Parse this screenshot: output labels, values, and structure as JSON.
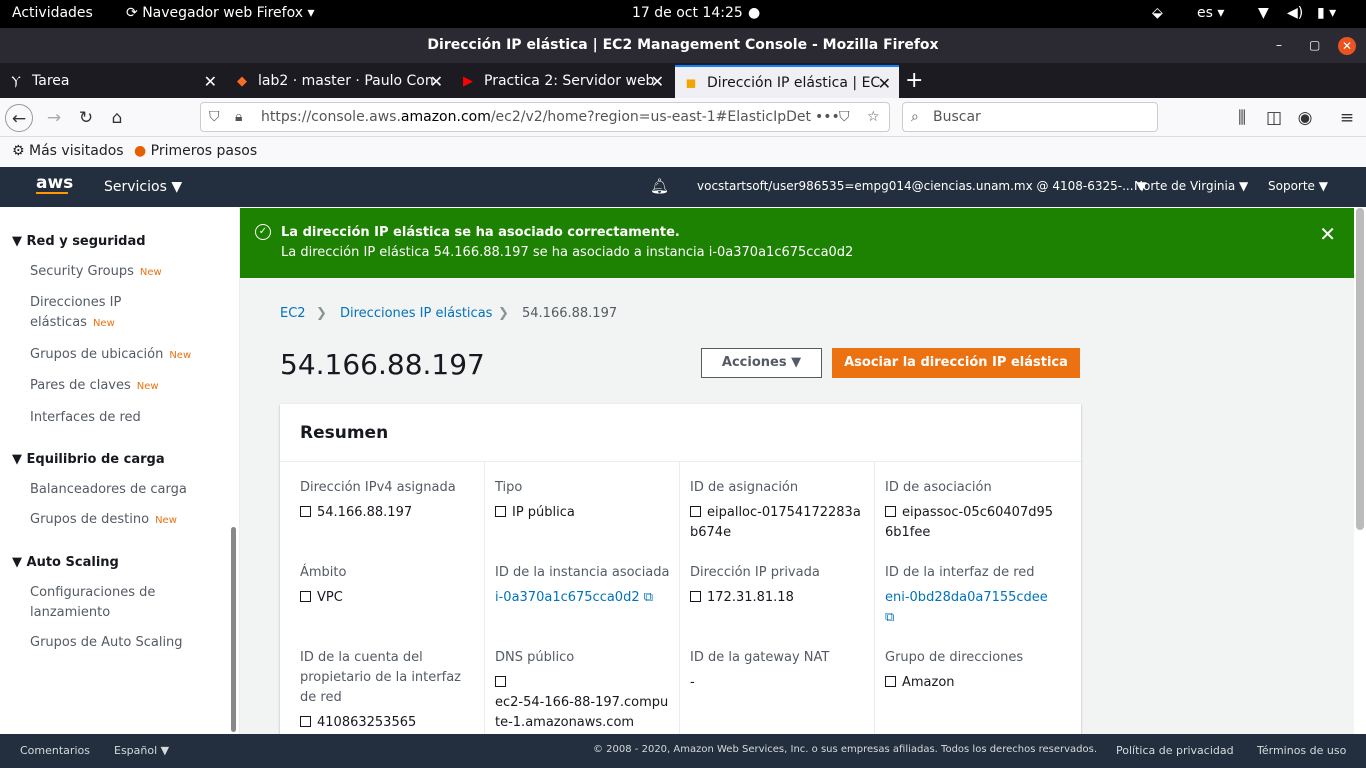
{
  "system": {
    "activities": "Actividades",
    "app": "Navegador web Firefox",
    "clock": "17 de oct  14:25",
    "lang": "es"
  },
  "window": {
    "title": "Dirección IP elástica | EC2 Management Console - Mozilla Firefox"
  },
  "tabs": [
    {
      "label": "Tarea"
    },
    {
      "label": "lab2 · master · Paulo Con"
    },
    {
      "label": "Practica 2: Servidor web"
    },
    {
      "label": "Dirección IP elástica | EC"
    }
  ],
  "url": {
    "prefix": "https://console.aws.",
    "domain": "amazon.com",
    "path": "/ec2/v2/home?region=us-east-1#ElasticIpDet"
  },
  "search": {
    "placeholder": "Buscar"
  },
  "bookmarks": {
    "most_visited": "Más visitados",
    "first_steps": "Primeros pasos"
  },
  "aws": {
    "logo": "aws",
    "services": "Servicios ▼",
    "account": "vocstartsoft/user986535=empg014@ciencias.unam.mx @ 4108-6325-... ▼",
    "region": "Norte de Virginia ▼",
    "support": "Soporte ▼"
  },
  "sidebar": {
    "sec1": "Red y seguridad",
    "sg": "Security Groups",
    "eip1": "Direcciones IP",
    "eip2": "elásticas",
    "pg": "Grupos de ubicación",
    "kp": "Pares de claves",
    "ni": "Interfaces de red",
    "sec2": "Equilibrio de carga",
    "lb": "Balanceadores de carga",
    "tg": "Grupos de destino",
    "sec3": "Auto Scaling",
    "lc1": "Configuraciones de",
    "lc2": "lanzamiento",
    "asg": "Grupos de Auto Scaling",
    "new": "New"
  },
  "flash": {
    "title": "La dirección IP elástica se ha asociado correctamente.",
    "body": "La dirección IP elástica 54.166.88.197 se ha asociado a instancia i-0a370a1c675cca0d2"
  },
  "breadcrumb": {
    "ec2": "EC2",
    "eips": "Direcciones IP elásticas",
    "current": "54.166.88.197"
  },
  "page": {
    "title": "54.166.88.197",
    "actions": "Acciones",
    "associate": "Asociar la dirección IP elástica"
  },
  "summary": {
    "heading": "Resumen",
    "fields": [
      {
        "label": "Dirección IPv4 asignada",
        "value": "54.166.88.197"
      },
      {
        "label": "Tipo",
        "value": "IP pública"
      },
      {
        "label": "ID de asignación",
        "value": "eipalloc-01754172283ab674e"
      },
      {
        "label": "ID de asociación",
        "value": "eipassoc-05c60407d956b1fee"
      },
      {
        "label": "Ámbito",
        "value": "VPC"
      },
      {
        "label": "ID de la instancia asociada",
        "value": "i-0a370a1c675cca0d2"
      },
      {
        "label": "Dirección IP privada",
        "value": "172.31.81.18"
      },
      {
        "label": "ID de la interfaz de red",
        "value": "eni-0bd28da0a7155cdee"
      },
      {
        "label": "ID de la cuenta del propietario de la interfaz de red",
        "value": "410863253565"
      },
      {
        "label": "DNS público",
        "value": "ec2-54-166-88-197.compute-1.amazonaws.com"
      },
      {
        "label": "ID de la gateway NAT",
        "value": "-"
      },
      {
        "label": "Grupo de direcciones",
        "value": "Amazon"
      }
    ]
  },
  "footer": {
    "feedback": "Comentarios",
    "lang": "Español ▼",
    "copyright": "© 2008 - 2020, Amazon Web Services, Inc. o sus empresas afiliadas. Todos los derechos reservados.",
    "privacy": "Política de privacidad",
    "terms": "Términos de uso"
  }
}
